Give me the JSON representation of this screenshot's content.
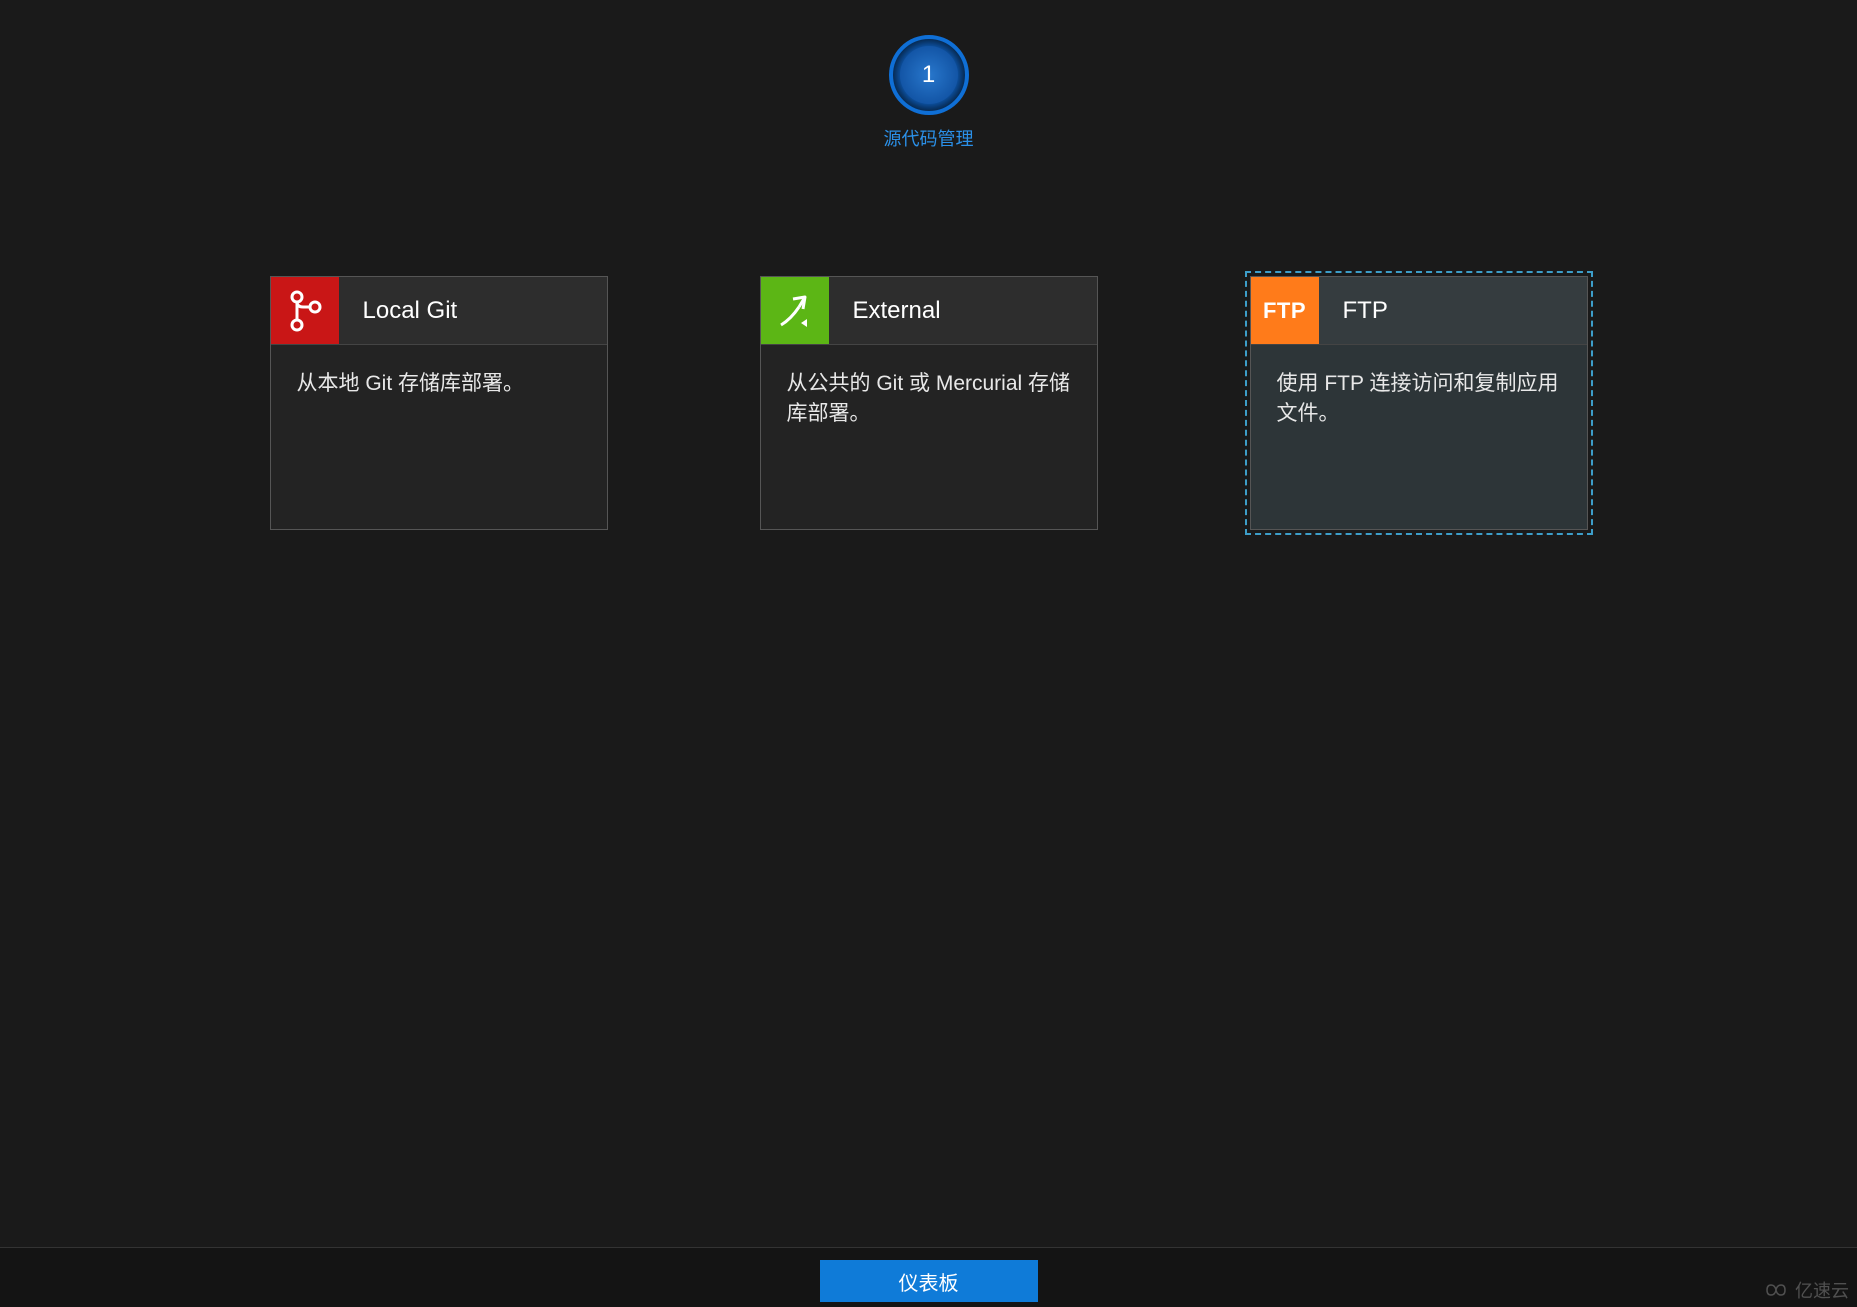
{
  "step": {
    "number": "1",
    "label": "源代码管理"
  },
  "cards": [
    {
      "id": "local-git",
      "title": "Local Git",
      "description": "从本地 Git 存储库部署。",
      "icon": "git",
      "iconColor": "#c91616",
      "selected": false
    },
    {
      "id": "external",
      "title": "External",
      "description": "从公共的 Git 或 Mercurial 存储库部署。",
      "icon": "external",
      "iconColor": "#5cb615",
      "selected": false
    },
    {
      "id": "ftp",
      "title": "FTP",
      "description": "使用 FTP 连接访问和复制应用文件。",
      "icon": "ftp",
      "iconText": "FTP",
      "iconColor": "#ff7b1a",
      "selected": true
    }
  ],
  "footer": {
    "dashboardButton": "仪表板"
  },
  "watermark": {
    "text": "亿速云"
  }
}
